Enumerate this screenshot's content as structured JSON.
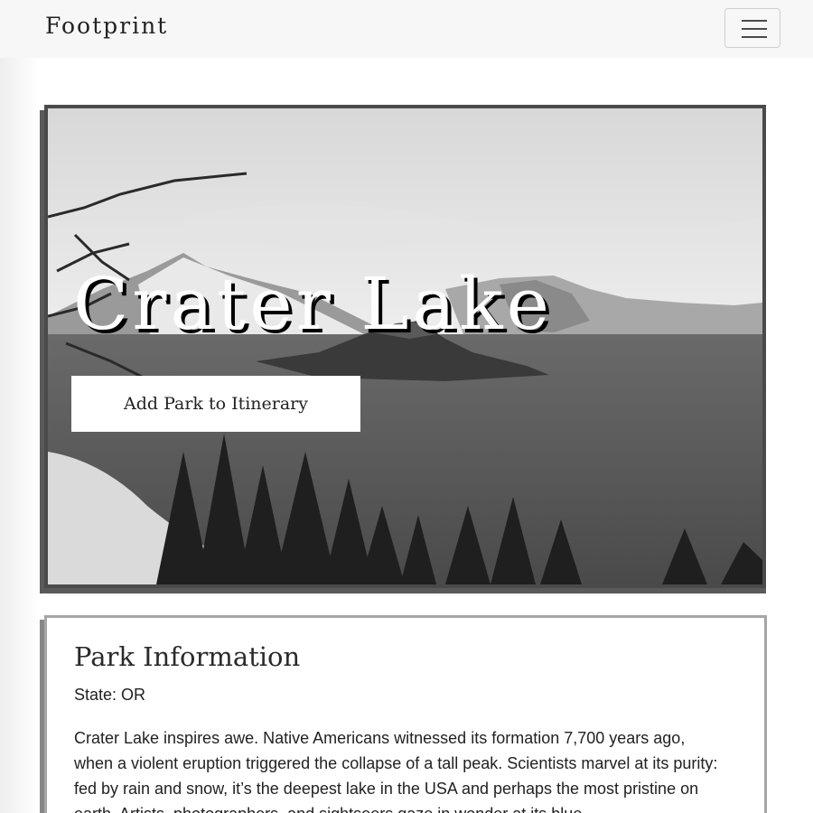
{
  "navbar": {
    "brand": "Footprint",
    "menu_icon": "hamburger-menu-icon"
  },
  "hero": {
    "title": "Crater Lake",
    "add_button_label": "Add Park to Itinerary",
    "image_alt": "black and white photo of Crater Lake with Wizard Island, snowy rim and pine trees"
  },
  "park_info": {
    "heading": "Park Information",
    "state_label": "State:",
    "state_value": "OR",
    "description": "Crater Lake inspires awe. Native Americans witnessed its formation 7,700 years ago, when a violent eruption triggered the collapse of a tall peak. Scientists marvel at its purity: fed by rain and snow, it’s the deepest lake in the USA and perhaps the most pristine on earth. Artists, photographers, and sightseers gaze in wonder at its blue"
  }
}
